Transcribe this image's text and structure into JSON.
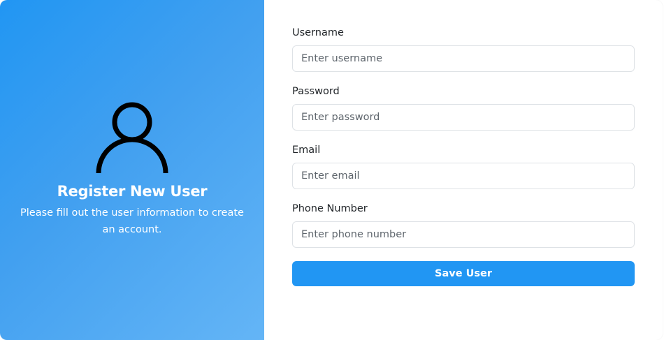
{
  "left_panel": {
    "icon": "user-icon",
    "title": "Register New User",
    "subtitle": "Please fill out the user information to create an account."
  },
  "form": {
    "fields": [
      {
        "label": "Username",
        "placeholder": "Enter username",
        "value": ""
      },
      {
        "label": "Password",
        "placeholder": "Enter password",
        "value": ""
      },
      {
        "label": "Email",
        "placeholder": "Enter email",
        "value": ""
      },
      {
        "label": "Phone Number",
        "placeholder": "Enter phone number",
        "value": ""
      }
    ],
    "submit_label": "Save User"
  },
  "colors": {
    "accent": "#2196f3",
    "panel_gradient_start": "#2196f3",
    "panel_gradient_end": "#64b5f6",
    "input_border": "#dee2e6",
    "text": "#212529"
  }
}
